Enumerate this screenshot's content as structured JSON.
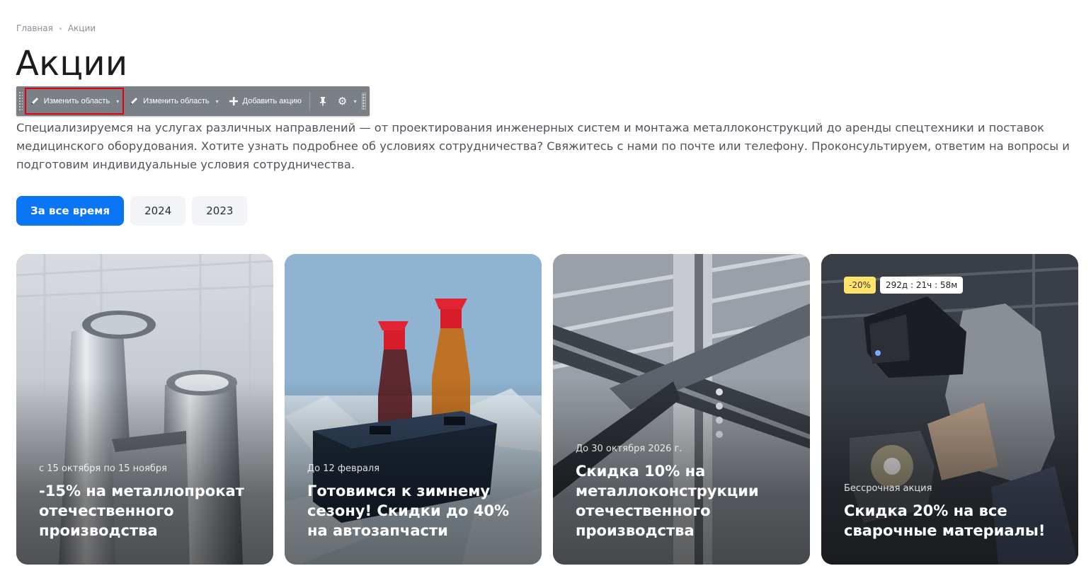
{
  "breadcrumb": {
    "home": "Главная",
    "current": "Акции"
  },
  "page_title": "Акции",
  "toolbar": {
    "edit_area_1": "Изменить область",
    "edit_area_2": "Изменить область",
    "add_promo": "Добавить акцию"
  },
  "description": "Специализируемся на услугах различных направлений — от проектирования инженерных систем и монтажа металлоконструкций до аренды спецтехники и поставок медицинского оборудования. Хотите узнать подробнее об условиях сотрудничества? Свяжитесь с нами по почте или телефону. Проконсультируем, ответим на вопросы и подготовим индивидуальные условия сотрудничества.",
  "filters": [
    {
      "label": "За все время",
      "active": true
    },
    {
      "label": "2024",
      "active": false
    },
    {
      "label": "2023",
      "active": false
    }
  ],
  "cards": [
    {
      "date": "с 15 октября по 15 ноября",
      "title": "-15% на металлопрокат отечественного производства"
    },
    {
      "date": "До 12 февраля",
      "title": "Готовимся к зимнему сезону! Скидки до 40% на автозапчасти"
    },
    {
      "date": "До 30 октября 2026 г.",
      "title": "Скидка 10% на металлоконструкции отечественного производства"
    },
    {
      "date": "Бессрочная акция",
      "title": "Скидка 20% на все сварочные материалы!",
      "discount": "-20%",
      "timer": "292д : 21ч : 58м"
    }
  ],
  "colors": {
    "accent": "#0a75f5",
    "discount_badge": "#ffe36b",
    "toolbar": "#7b7f86",
    "highlight": "#e3000f"
  }
}
